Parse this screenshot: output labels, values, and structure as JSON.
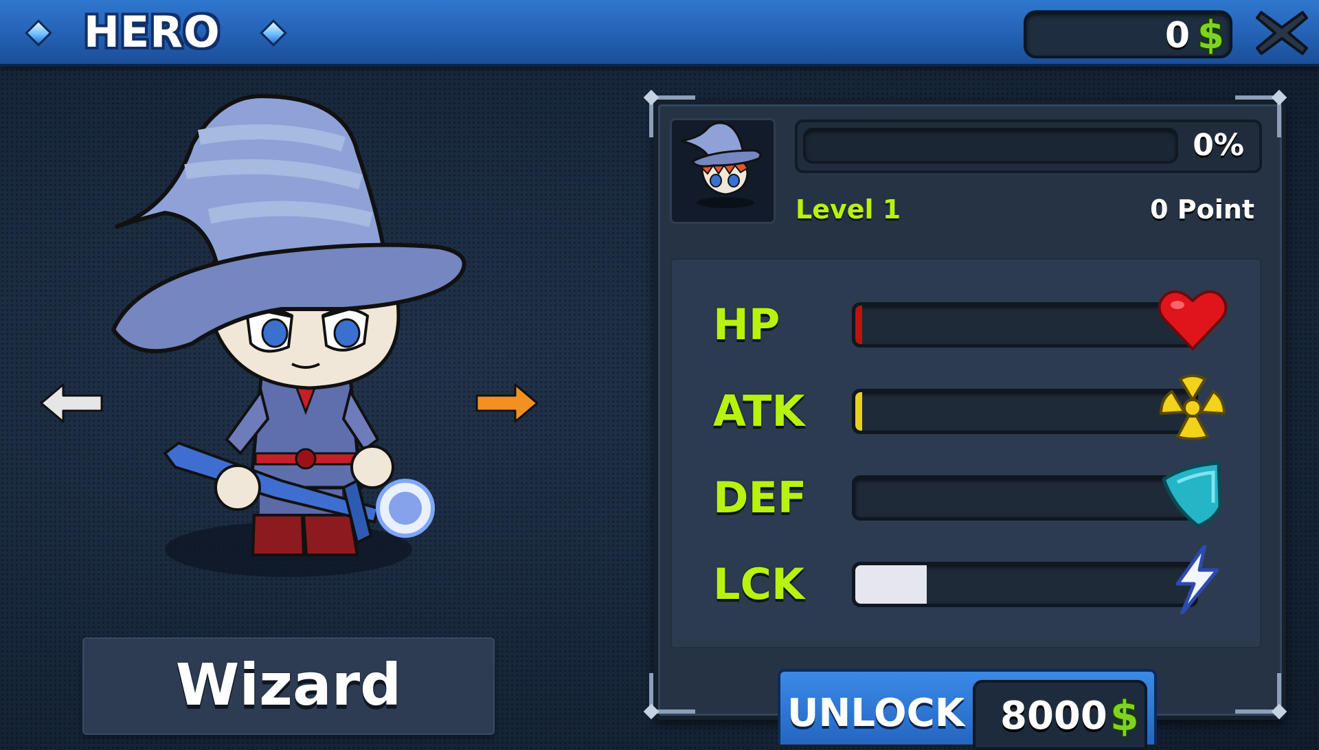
{
  "header": {
    "title": "HERO",
    "coins": "0",
    "currency_symbol": "$",
    "close_icon": "close-x-icon"
  },
  "hero": {
    "name": "Wizard",
    "prev_icon": "arrow-left-icon",
    "next_icon": "arrow-right-icon"
  },
  "progress": {
    "percent_label": "0%",
    "fraction": 0.0,
    "level": "Level 1",
    "points": "0 Point"
  },
  "stats": [
    {
      "label": "HP",
      "fraction": 0.02,
      "color": "#c01010",
      "icon": "heart-icon"
    },
    {
      "label": "ATK",
      "fraction": 0.02,
      "color": "#e6d21a",
      "icon": "radiation-icon"
    },
    {
      "label": "DEF",
      "fraction": 0.0,
      "color": "#1fa9b8",
      "icon": "shield-icon"
    },
    {
      "label": "LCK",
      "fraction": 0.21,
      "color": "#e6e6ee",
      "icon": "lightning-icon"
    }
  ],
  "unlock": {
    "label": "UNLOCK",
    "price": "8000",
    "currency_symbol": "$"
  },
  "colors": {
    "accent_green": "#b8f20f",
    "header_blue": "#2a6cc6",
    "panel_bg": "#263345"
  }
}
